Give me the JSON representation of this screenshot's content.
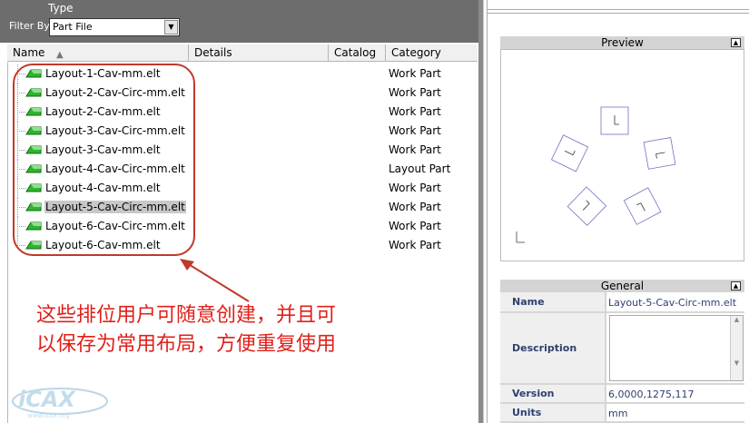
{
  "header": {
    "type_label": "Type",
    "filter_label": "Filter By:",
    "filter_value": "Part File"
  },
  "columns": {
    "name": "Name",
    "details": "Details",
    "catalog": "Catalog",
    "category": "Category"
  },
  "files": [
    {
      "name": "Layout-1-Cav-mm.elt",
      "category": "Work Part",
      "selected": false
    },
    {
      "name": "Layout-2-Cav-Circ-mm.elt",
      "category": "Work Part",
      "selected": false
    },
    {
      "name": "Layout-2-Cav-mm.elt",
      "category": "Work Part",
      "selected": false
    },
    {
      "name": "Layout-3-Cav-Circ-mm.elt",
      "category": "Work Part",
      "selected": false
    },
    {
      "name": "Layout-3-Cav-mm.elt",
      "category": "Work Part",
      "selected": false
    },
    {
      "name": "Layout-4-Cav-Circ-mm.elt",
      "category": "Layout Part",
      "selected": false
    },
    {
      "name": "Layout-4-Cav-mm.elt",
      "category": "Work Part",
      "selected": false
    },
    {
      "name": "Layout-5-Cav-Circ-mm.elt",
      "category": "Work Part",
      "selected": true
    },
    {
      "name": "Layout-6-Cav-Circ-mm.elt",
      "category": "Work Part",
      "selected": false
    },
    {
      "name": "Layout-6-Cav-mm.elt",
      "category": "Work Part",
      "selected": false
    }
  ],
  "annotation": {
    "line1": "这些排位用户可随意创建，并且可",
    "line2": "以保存为常用布局，方便重复使用"
  },
  "watermark": {
    "text": "iCAX",
    "url": "www.icax.org"
  },
  "preview": {
    "title": "Preview"
  },
  "general": {
    "title": "General",
    "name_label": "Name",
    "name_value": "Layout-5-Cav-Circ-mm.elt",
    "description_label": "Description",
    "version_label": "Version",
    "version_value": "6,0000,1275,117",
    "units_label": "Units",
    "units_value": "mm"
  },
  "colors": {
    "annotation_red": "#e0201a",
    "icon_green": "#2fb52f",
    "panel_text": "#2f3f6f"
  },
  "icons": {
    "file": "part-file-icon",
    "collapse": "collapse-icon"
  }
}
